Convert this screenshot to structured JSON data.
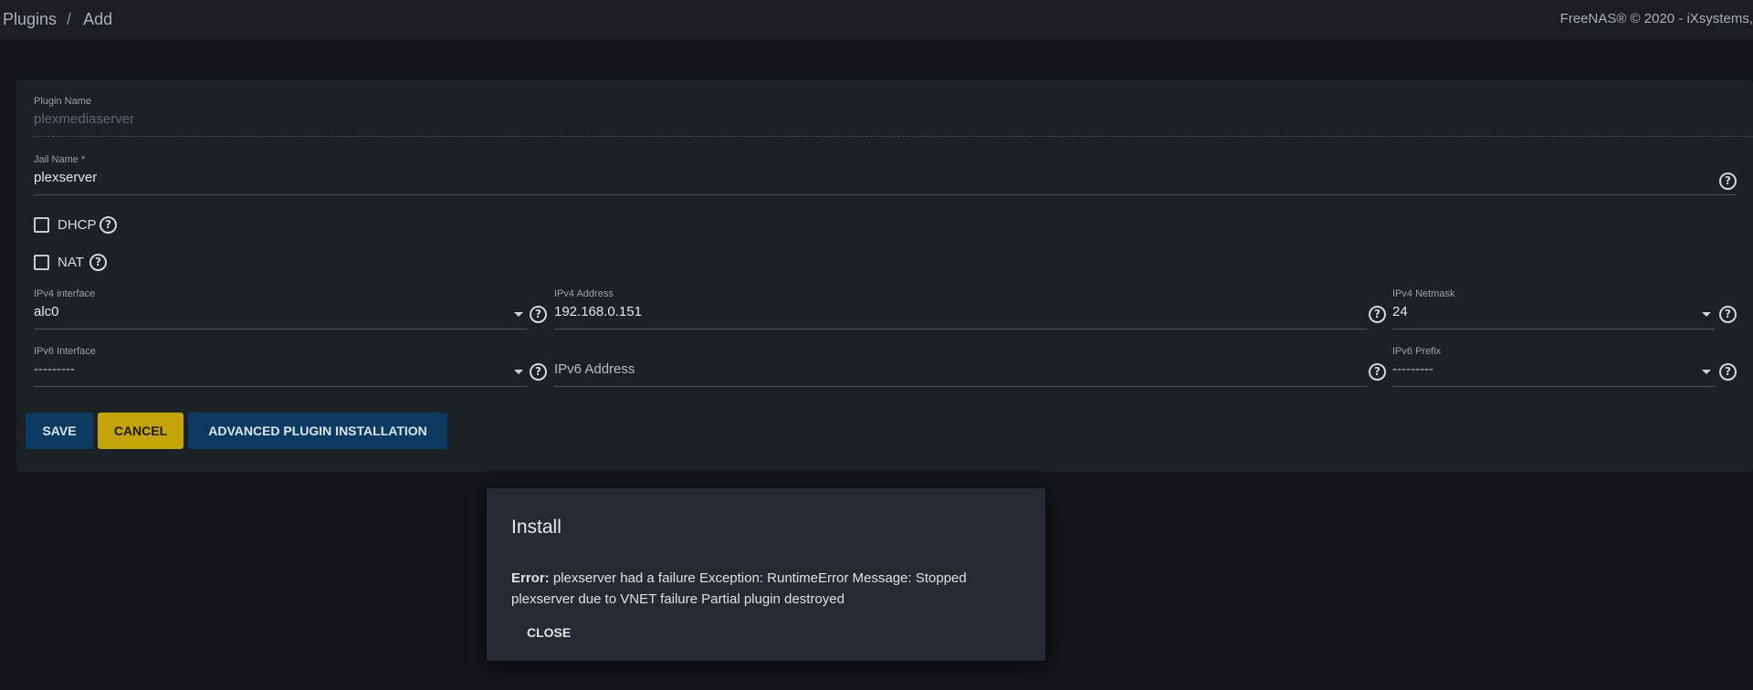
{
  "header": {
    "breadcrumb": [
      "Plugins",
      "Add"
    ],
    "separator": "/",
    "copyright": "FreeNAS® © 2020 - iXsystems,"
  },
  "form": {
    "plugin_name": {
      "label": "Plugin Name",
      "value": "plexmediaserver"
    },
    "jail_name": {
      "label": "Jail Name *",
      "value": "plexserver"
    },
    "dhcp": {
      "label": "DHCP",
      "checked": false
    },
    "nat": {
      "label": "NAT",
      "checked": false
    },
    "ipv4_interface": {
      "label": "IPv4 interface",
      "value": "alc0"
    },
    "ipv4_address": {
      "label": "IPv4 Address",
      "value": "192.168.0.151"
    },
    "ipv4_netmask": {
      "label": "IPv4 Netmask",
      "value": "24"
    },
    "ipv6_interface": {
      "label": "IPv6 Interface",
      "value": "---------"
    },
    "ipv6_address": {
      "placeholder": "IPv6 Address",
      "value": ""
    },
    "ipv6_prefix": {
      "label": "IPv6 Prefix",
      "value": "---------"
    }
  },
  "buttons": {
    "save": "SAVE",
    "cancel": "CANCEL",
    "advanced": "ADVANCED PLUGIN INSTALLATION"
  },
  "dialog": {
    "title": "Install",
    "error_prefix": "Error:",
    "message": "plexserver had a failure Exception: RuntimeError Message: Stopped plexserver due to VNET failure Partial plugin destroyed",
    "close_label": "CLOSE"
  },
  "icons": {
    "help": "help-circle-icon",
    "dropdown": "caret-down-icon",
    "checkbox": "checkbox-unchecked-icon"
  },
  "colors": {
    "primary_button": "#0c3a61",
    "cancel_button": "#c5a40a",
    "background": "#121519",
    "card": "#1c2126",
    "dialog": "#252b31"
  }
}
